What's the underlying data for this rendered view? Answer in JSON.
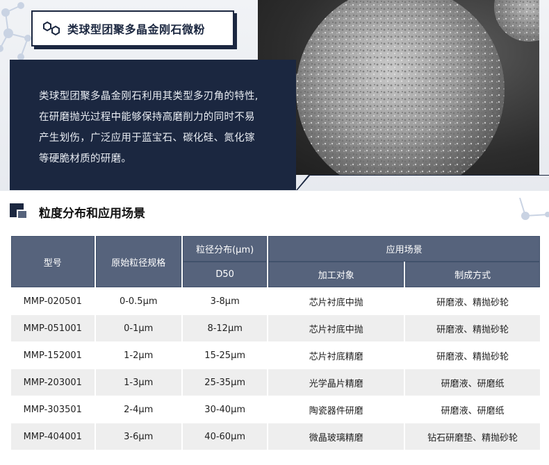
{
  "product": {
    "title": "类球型团聚多晶金刚石微粉",
    "description_lines": [
      "类球型团聚多晶金刚石利用其类型多刃角的特性,",
      "在研磨抛光过程中能够保持高磨削力的同时不易",
      "产生划伤，广泛应用于蓝宝石、碳化硅、氮化镓",
      "等硬脆材质的研磨。"
    ]
  },
  "section": {
    "title": "粒度分布和应用场景"
  },
  "table": {
    "headers": {
      "model": "型号",
      "raw_size": "原始粒径规格",
      "psd": "粒径分布(μm)",
      "psd_sub": "D50",
      "application": "应用场景",
      "target": "加工对象",
      "method": "制成方式"
    },
    "rows": [
      {
        "model": "MMP-020501",
        "raw": "0-0.5μm",
        "d50": "3-8μm",
        "target": "芯片衬底中抛",
        "method": "研磨液、精抛砂轮"
      },
      {
        "model": "MMP-051001",
        "raw": "0-1μm",
        "d50": "8-12μm",
        "target": "芯片衬底中抛",
        "method": "研磨液、精抛砂轮"
      },
      {
        "model": "MMP-152001",
        "raw": "1-2μm",
        "d50": "15-25μm",
        "target": "芯片衬底精磨",
        "method": "研磨液、精抛砂轮"
      },
      {
        "model": "MMP-203001",
        "raw": "1-3μm",
        "d50": "25-35μm",
        "target": "光学晶片精磨",
        "method": "研磨液、研磨纸"
      },
      {
        "model": "MMP-303501",
        "raw": "2-4μm",
        "d50": "30-40μm",
        "target": "陶瓷器件研磨",
        "method": "研磨液、研磨纸"
      },
      {
        "model": "MMP-404001",
        "raw": "3-6μm",
        "d50": "40-60μm",
        "target": "微晶玻璃精磨",
        "method": "钻石研磨垫、精抛砂轮"
      }
    ]
  },
  "colors": {
    "navy": "#1b2740",
    "header_gray_blue": "#56637c",
    "row_stripe": "#eeeeee"
  },
  "icons": {
    "title_icon": "hexagon-molecule-icon",
    "section_icon": "stacked-squares-icon"
  }
}
